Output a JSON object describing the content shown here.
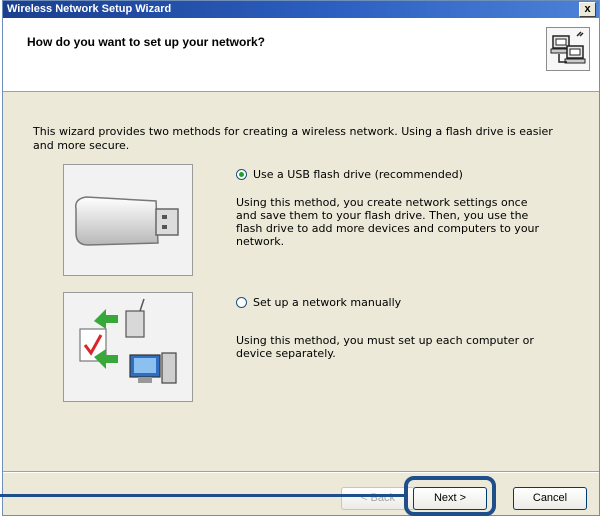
{
  "window": {
    "title": "Wireless Network Setup Wizard",
    "close_label": "x"
  },
  "header": {
    "title": "How do you want to set up your network?",
    "icon": "network-computers-icon"
  },
  "intro": "This wizard provides two methods for creating a wireless network. Using a flash drive is easier and more secure.",
  "options": [
    {
      "label": "Use a USB flash drive (recommended)",
      "selected": true,
      "description": "Using this method, you create network settings once and save them to your flash drive. Then, you use the flash drive to add more devices and computers to your network.",
      "icon": "usb-flash-drive-icon"
    },
    {
      "label": "Set up a network manually",
      "selected": false,
      "description": "Using this method, you must set up each computer or device separately.",
      "icon": "manual-setup-icon"
    }
  ],
  "buttons": {
    "back": "< Back",
    "next": "Next >",
    "cancel": "Cancel"
  },
  "colors": {
    "titlebar": "#2c5fc0",
    "callout": "#1f4f8a",
    "radio_dot": "#21a121"
  }
}
